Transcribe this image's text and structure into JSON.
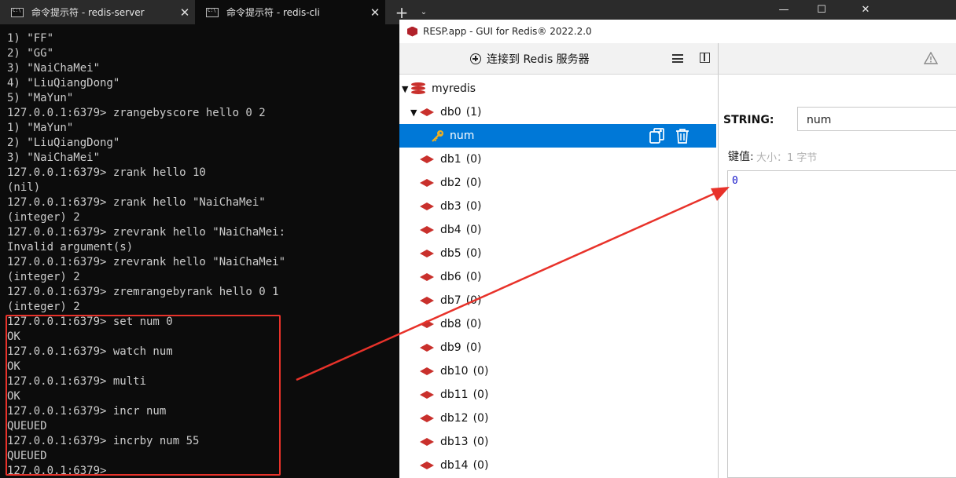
{
  "tabs": [
    {
      "title": "命令提示符 - redis-server",
      "close": "✕"
    },
    {
      "title": "命令提示符 - redis-cli",
      "close": "✕"
    }
  ],
  "tabbar": {
    "new_tab": "+",
    "dropdown": "⌄"
  },
  "window_controls": {
    "minimize": "—",
    "maximize": "☐",
    "close": "✕"
  },
  "terminal": {
    "lines": [
      "1) \"FF\"",
      "2) \"GG\"",
      "3) \"NaiChaMei\"",
      "4) \"LiuQiangDong\"",
      "5) \"MaYun\"",
      "127.0.0.1:6379> zrangebyscore hello 0 2",
      "1) \"MaYun\"",
      "2) \"LiuQiangDong\"",
      "3) \"NaiChaMei\"",
      "127.0.0.1:6379> zrank hello 10",
      "(nil)",
      "127.0.0.1:6379> zrank hello \"NaiChaMei\"",
      "(integer) 2",
      "127.0.0.1:6379> zrevrank hello \"NaiChaMei:",
      "Invalid argument(s)",
      "127.0.0.1:6379> zrevrank hello \"NaiChaMei\"",
      "(integer) 2",
      "127.0.0.1:6379> zremrangebyrank hello 0 1",
      "(integer) 2",
      "127.0.0.1:6379> set num 0",
      "OK",
      "127.0.0.1:6379> watch num",
      "OK",
      "127.0.0.1:6379> multi",
      "OK",
      "127.0.0.1:6379> incr num",
      "QUEUED",
      "127.0.0.1:6379> incrby num 55",
      "QUEUED",
      "127.0.0.1:6379>"
    ]
  },
  "resp": {
    "window_title": "RESP.app - GUI for Redis® 2022.2.0",
    "toolbar": {
      "connect_label": "连接到 Redis 服务器"
    },
    "tree": {
      "connection": "myredis",
      "expanded_db": {
        "name": "db0",
        "count": "(1)"
      },
      "selected_key": "num",
      "dbs": [
        {
          "name": "db1",
          "count": "(0)"
        },
        {
          "name": "db2",
          "count": "(0)"
        },
        {
          "name": "db3",
          "count": "(0)"
        },
        {
          "name": "db4",
          "count": "(0)"
        },
        {
          "name": "db5",
          "count": "(0)"
        },
        {
          "name": "db6",
          "count": "(0)"
        },
        {
          "name": "db7",
          "count": "(0)"
        },
        {
          "name": "db8",
          "count": "(0)"
        },
        {
          "name": "db9",
          "count": "(0)"
        },
        {
          "name": "db10",
          "count": "(0)"
        },
        {
          "name": "db11",
          "count": "(0)"
        },
        {
          "name": "db12",
          "count": "(0)"
        },
        {
          "name": "db13",
          "count": "(0)"
        },
        {
          "name": "db14",
          "count": "(0)"
        }
      ]
    },
    "detail": {
      "type_label": "STRING:",
      "key_name": "num",
      "value_label": "键值:",
      "size_hint": "大小：1 字节",
      "value": "0"
    }
  },
  "colors": {
    "highlight": "#e8322a",
    "selection": "#0078d7",
    "redis_red": "#c9302c"
  }
}
